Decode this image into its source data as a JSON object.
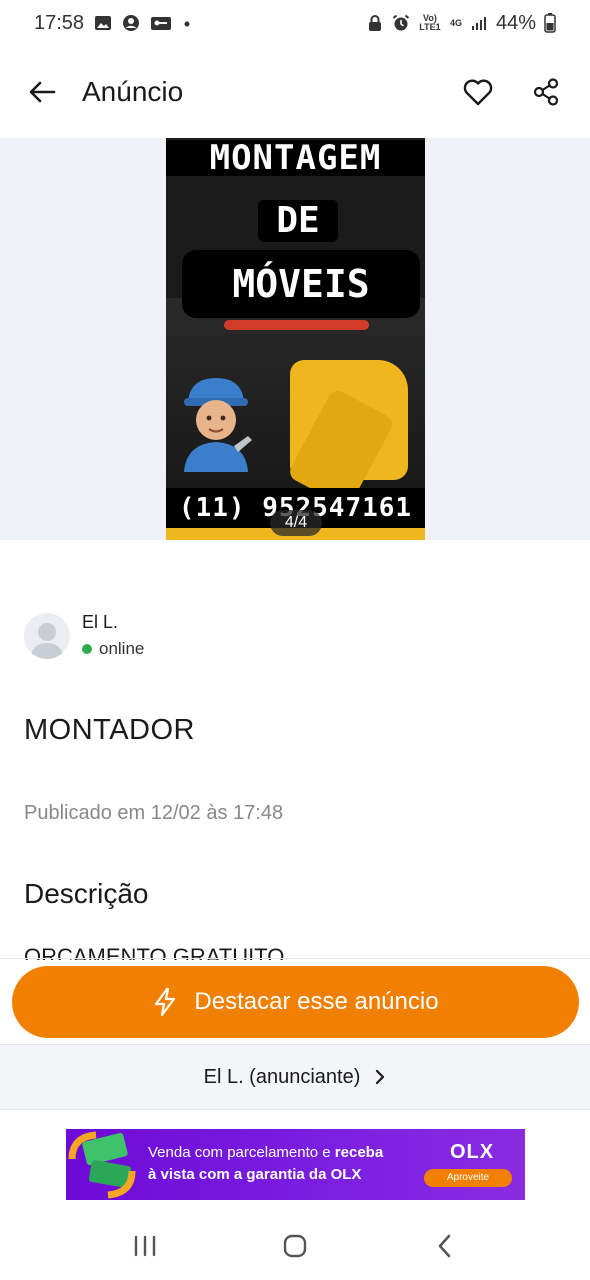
{
  "status_bar": {
    "time": "17:58",
    "battery": "44%",
    "network": "4G",
    "volte": "Vo) LTE1",
    "icons": [
      "image-icon",
      "account-circle-icon",
      "key-icon",
      "dot-icon",
      "lock-icon",
      "alarm-icon",
      "signal-icon",
      "battery-icon"
    ]
  },
  "app_bar": {
    "title": "Anúncio",
    "icons": [
      "back-arrow-icon",
      "heart-icon",
      "share-icon"
    ]
  },
  "gallery": {
    "counter": "4/4",
    "image_text": {
      "line1": "MONTAGEM",
      "line2": "DE",
      "line3": "MÓVEIS",
      "phone": "(11) 952547161"
    }
  },
  "seller": {
    "name": "El L.",
    "status": "online",
    "status_color": "#2fab4f"
  },
  "ad": {
    "title": "MONTADOR",
    "published": "Publicado em 12/02 às 17:48",
    "description_heading": "Descrição",
    "description_text": "ORCAMENTO GRATUITO"
  },
  "actions": {
    "highlight_label": "Destacar esse anúncio",
    "owner_label": "El L. (anunciante)",
    "accent_color": "#f28000"
  },
  "banner": {
    "text_part1": "Venda com parcelamento e ",
    "text_bold1": "receba",
    "text_bold2": "à vista com a garantia da OLX",
    "logo": "OLX",
    "button": "Aproveite",
    "bg_color": "#6e0ad6"
  },
  "nav_bar": {
    "icons": [
      "recent-apps-icon",
      "home-icon",
      "back-icon"
    ]
  }
}
